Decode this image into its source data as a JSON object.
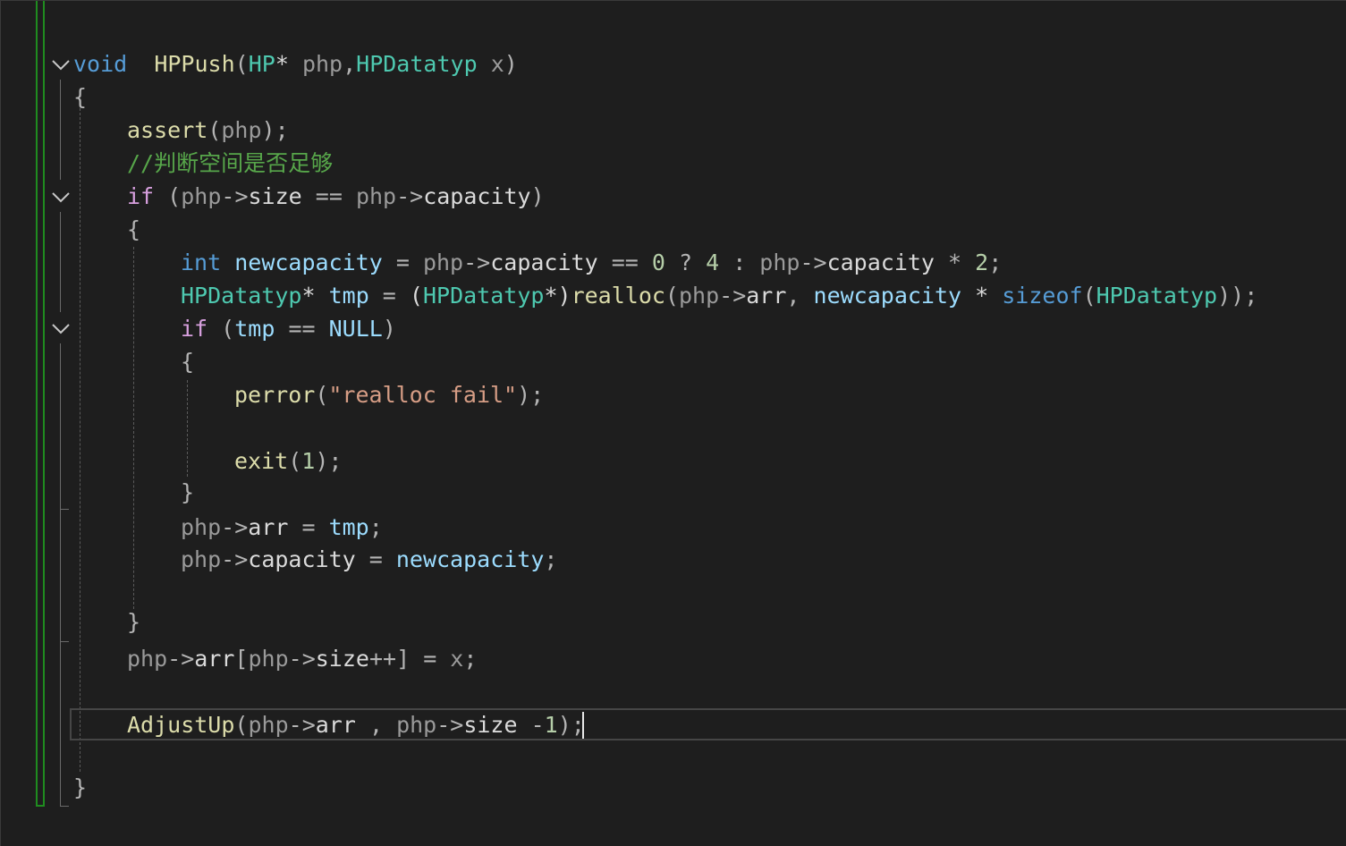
{
  "editor": {
    "theme_colors": {
      "background": "#1e1e1e",
      "keyword": "#569cd6",
      "function": "#dcdcaa",
      "type": "#4ec9b0",
      "parameter": "#9a9a9a",
      "member": "#dadada",
      "local": "#9cdcfe",
      "number": "#b5cea8",
      "string": "#d69d85",
      "comment": "#57a64a",
      "change_bar": "#1f8c1f"
    },
    "icons": {
      "fold_toggle": "chevron-down-icon",
      "change_marker": "change-bar"
    },
    "code": {
      "l1": {
        "kw_void": "void",
        "sp1": "  ",
        "fn": "HPPush",
        "p1": "(",
        "ty1": "HP",
        "star": "*",
        "sp2": " ",
        "par1": "php",
        "comma": ",",
        "ty2": "HPDatatyp",
        "sp3": " ",
        "par2": "x",
        "p2": ")"
      },
      "l2": {
        "brace": "{"
      },
      "l3": {
        "fn": "assert",
        "p1": "(",
        "par": "php",
        "p2": ")",
        "semi": ";"
      },
      "l4": {
        "comment": "//判断空间是否足够"
      },
      "l5": {
        "kw_if": "if",
        "sp": " ",
        "p1": "(",
        "par1": "php",
        "arrow1": "->",
        "mb1": "size",
        "op": " == ",
        "par2": "php",
        "arrow2": "->",
        "mb2": "capacity",
        "p2": ")"
      },
      "l6": {
        "brace": "{"
      },
      "l7": {
        "kw_int": "int",
        "sp": " ",
        "var": "newcapacity",
        "eq": " = ",
        "par1": "php",
        "arrow1": "->",
        "mb1": "capacity",
        "op1": " == ",
        "n0": "0",
        "q": " ? ",
        "n4": "4",
        "colon": " : ",
        "par2": "php",
        "arrow2": "->",
        "mb2": "capacity",
        "mul": " * ",
        "n2": "2",
        "semi": ";"
      },
      "l8": {
        "ty1": "HPDatatyp",
        "star1": "*",
        "sp": " ",
        "var": "tmp",
        "eq": " = ",
        "p1": "(",
        "ty2": "HPDatatyp",
        "star2": "*",
        "p2": ")",
        "fn": "realloc",
        "p3": "(",
        "par1": "php",
        "arrow": "->",
        "mb": "arr",
        "comma": ", ",
        "var2": "newcapacity",
        "mul": " * ",
        "kw_sizeof": "sizeof",
        "p4": "(",
        "ty3": "HPDatatyp",
        "p5": "))",
        "semi": ";"
      },
      "l9": {
        "kw_if": "if",
        "sp": " ",
        "p1": "(",
        "var": "tmp",
        "op": " == ",
        "mac": "NULL",
        "p2": ")"
      },
      "l10": {
        "brace": "{"
      },
      "l11": {
        "fn": "perror",
        "p1": "(",
        "str": "\"realloc fail\"",
        "p2": ")",
        "semi": ";"
      },
      "l12": {
        "fn": "exit",
        "p1": "(",
        "num": "1",
        "p2": ")",
        "semi": ";"
      },
      "l13": {
        "brace": "}"
      },
      "l14": {
        "par": "php",
        "arrow": "->",
        "mb": "arr",
        "eq": " = ",
        "var": "tmp",
        "semi": ";"
      },
      "l15": {
        "par": "php",
        "arrow": "->",
        "mb": "capacity",
        "eq": " = ",
        "var": "newcapacity",
        "semi": ";"
      },
      "l16": {
        "brace": "}"
      },
      "l17": {
        "par1": "php",
        "arrow1": "->",
        "mb1": "arr",
        "b1": "[",
        "par2": "php",
        "arrow2": "->",
        "mb2": "size",
        "inc": "++",
        "b2": "]",
        "eq": " = ",
        "par3": "x",
        "semi": ";"
      },
      "l18": {
        "fn": "AdjustUp",
        "p1": "(",
        "par1": "php",
        "arrow1": "->",
        "mb1": "arr",
        "comma": " , ",
        "par2": "php",
        "arrow2": "->",
        "mb2": "size",
        "op": " -",
        "num": "1",
        "p2": ")",
        "semi": ";"
      },
      "l19": {
        "brace": "}"
      }
    }
  }
}
